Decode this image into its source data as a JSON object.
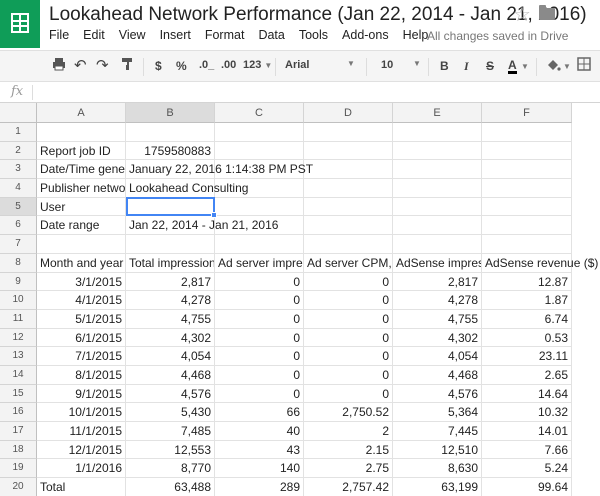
{
  "app": {
    "title": "Lookahead Network Performance (Jan 22, 2014 - Jan 21, 2016)",
    "save_status": "All changes saved in Drive",
    "menu": [
      "File",
      "Edit",
      "View",
      "Insert",
      "Format",
      "Data",
      "Tools",
      "Add-ons",
      "Help"
    ]
  },
  "toolbar": {
    "currency": "$",
    "percent": "%",
    "decrease_decimals": ".0_",
    "increase_decimals": ".00",
    "more_formats": "123",
    "font": "Arial",
    "font_size": "10",
    "bold": "B",
    "italic": "I",
    "strike": "S",
    "text_color": "A",
    "accent_color": "#0f9d58",
    "icons": [
      "print-icon",
      "undo-icon",
      "redo-icon",
      "paint-format-icon",
      "fill-color-icon",
      "borders-icon"
    ]
  },
  "formula_bar": {
    "fx": "fx",
    "value": ""
  },
  "grid": {
    "columns": [
      "A",
      "B",
      "C",
      "D",
      "E",
      "F"
    ],
    "selected_column": "B",
    "selected_row": "5",
    "rows": [
      {
        "n": "1",
        "a": "",
        "b": "",
        "c": "",
        "d": "",
        "e": "",
        "f": ""
      },
      {
        "n": "2",
        "a": "Report job ID",
        "b": "1759580883",
        "c": "",
        "d": "",
        "e": "",
        "f": ""
      },
      {
        "n": "3",
        "a": "Date/Time gener",
        "b": "January 22, 2016 1:14:38 PM PST",
        "c": "",
        "d": "",
        "e": "",
        "f": ""
      },
      {
        "n": "4",
        "a": "Publisher networ",
        "b": "Lookahead Consulting",
        "c": "",
        "d": "",
        "e": "",
        "f": ""
      },
      {
        "n": "5",
        "a": "User",
        "b": "",
        "c": "",
        "d": "",
        "e": "",
        "f": ""
      },
      {
        "n": "6",
        "a": "Date range",
        "b": "Jan 22, 2014 - Jan 21, 2016",
        "c": "",
        "d": "",
        "e": "",
        "f": ""
      },
      {
        "n": "7",
        "a": "",
        "b": "",
        "c": "",
        "d": "",
        "e": "",
        "f": ""
      },
      {
        "n": "8",
        "a": "Month and year",
        "b": "Total impression",
        "c": "Ad server impres",
        "d": "Ad server CPM,",
        "e": "AdSense impres",
        "f": "AdSense revenue ($)"
      },
      {
        "n": "9",
        "a": "3/1/2015",
        "b": "2,817",
        "c": "0",
        "d": "0",
        "e": "2,817",
        "f": "12.87"
      },
      {
        "n": "10",
        "a": "4/1/2015",
        "b": "4,278",
        "c": "0",
        "d": "0",
        "e": "4,278",
        "f": "1.87"
      },
      {
        "n": "11",
        "a": "5/1/2015",
        "b": "4,755",
        "c": "0",
        "d": "0",
        "e": "4,755",
        "f": "6.74"
      },
      {
        "n": "12",
        "a": "6/1/2015",
        "b": "4,302",
        "c": "0",
        "d": "0",
        "e": "4,302",
        "f": "0.53"
      },
      {
        "n": "13",
        "a": "7/1/2015",
        "b": "4,054",
        "c": "0",
        "d": "0",
        "e": "4,054",
        "f": "23.11"
      },
      {
        "n": "14",
        "a": "8/1/2015",
        "b": "4,468",
        "c": "0",
        "d": "0",
        "e": "4,468",
        "f": "2.65"
      },
      {
        "n": "15",
        "a": "9/1/2015",
        "b": "4,576",
        "c": "0",
        "d": "0",
        "e": "4,576",
        "f": "14.64"
      },
      {
        "n": "16",
        "a": "10/1/2015",
        "b": "5,430",
        "c": "66",
        "d": "2,750.52",
        "e": "5,364",
        "f": "10.32"
      },
      {
        "n": "17",
        "a": "11/1/2015",
        "b": "7,485",
        "c": "40",
        "d": "2",
        "e": "7,445",
        "f": "14.01"
      },
      {
        "n": "18",
        "a": "12/1/2015",
        "b": "12,553",
        "c": "43",
        "d": "2.15",
        "e": "12,510",
        "f": "7.66"
      },
      {
        "n": "19",
        "a": "1/1/2016",
        "b": "8,770",
        "c": "140",
        "d": "2.75",
        "e": "8,630",
        "f": "5.24"
      },
      {
        "n": "20",
        "a": "Total",
        "b": "63,488",
        "c": "289",
        "d": "2,757.42",
        "e": "63,199",
        "f": "99.64"
      }
    ]
  }
}
